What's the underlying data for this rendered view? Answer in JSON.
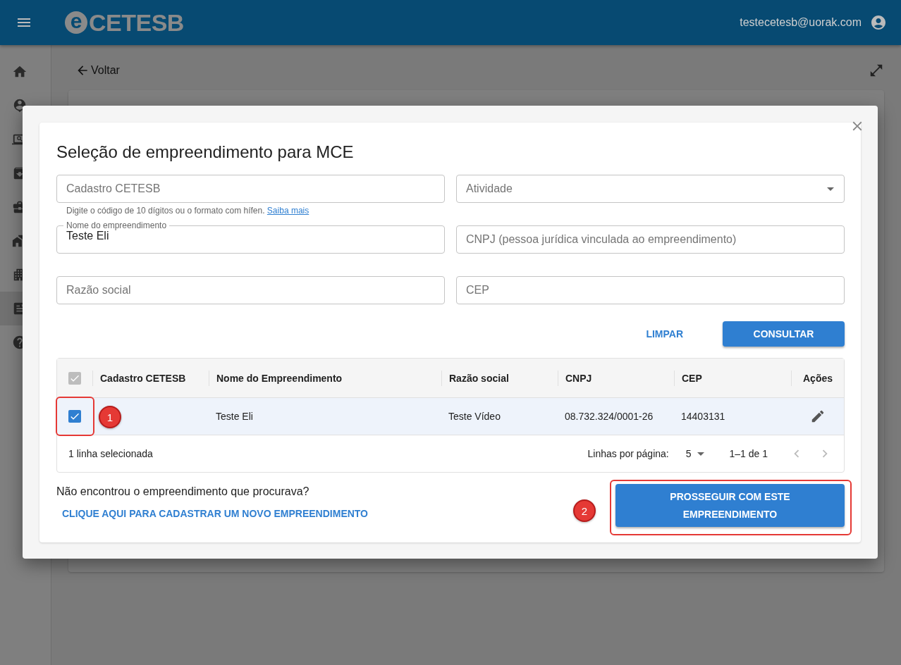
{
  "header": {
    "logo_mark": "e",
    "logo_name": "CETESB",
    "user_email": "testecetesb@uorak.com"
  },
  "sidebar": {
    "items": [
      {
        "selected": false
      },
      {
        "selected": false
      },
      {
        "selected": false
      },
      {
        "selected": false
      },
      {
        "selected": false
      },
      {
        "selected": false
      },
      {
        "selected": false
      },
      {
        "selected": true
      },
      {
        "selected": false
      }
    ]
  },
  "page": {
    "back_label": "Voltar"
  },
  "dialog": {
    "title": "Seleção de empreendimento para MCE",
    "fields": [
      {
        "kind": "text",
        "placeholder": "Cadastro CETESB",
        "helper": "Digite o código de 10 dígitos ou o formato com hífen.",
        "helper_link": "Saiba mais"
      },
      {
        "kind": "select",
        "placeholder": "Atividade"
      },
      {
        "kind": "text",
        "label": "Nome do empreendimento",
        "value": "Teste Eli"
      },
      {
        "kind": "text",
        "placeholder": "CNPJ (pessoa jurídica vinculada ao empreendimento)"
      },
      {
        "kind": "text",
        "placeholder": "Razão social"
      },
      {
        "kind": "text",
        "placeholder": "CEP"
      }
    ],
    "actions": [
      "LIMPAR",
      "CONSULTAR"
    ],
    "table": {
      "select_all": {
        "checked": true,
        "disabled": true
      },
      "columns": [
        "Cadastro CETESB",
        "Nome do Empreendimento",
        "Razão social",
        "CNPJ",
        "CEP",
        "Ações"
      ],
      "rows": [
        {
          "selected": true,
          "cells": [
            "",
            "Teste Eli",
            "Teste Vídeo",
            "08.732.324/0001-26",
            "14403131"
          ]
        }
      ],
      "footer": {
        "selection": "1 linha selecionada",
        "rows_per_page_label": "Linhas por página:",
        "rows_per_page": "5",
        "range": "1–1 de 1"
      }
    },
    "not_found_text": "Não encontrou o empreendimento que procurava?",
    "register_link": "CLIQUE AQUI PARA CADASTRAR UM NOVO EMPREENDIMENTO",
    "proceed_button": "PROSSEGUIR COM ESTE EMPREENDIMENTO",
    "annotations": [
      {
        "number": "1"
      },
      {
        "number": "2"
      }
    ]
  }
}
